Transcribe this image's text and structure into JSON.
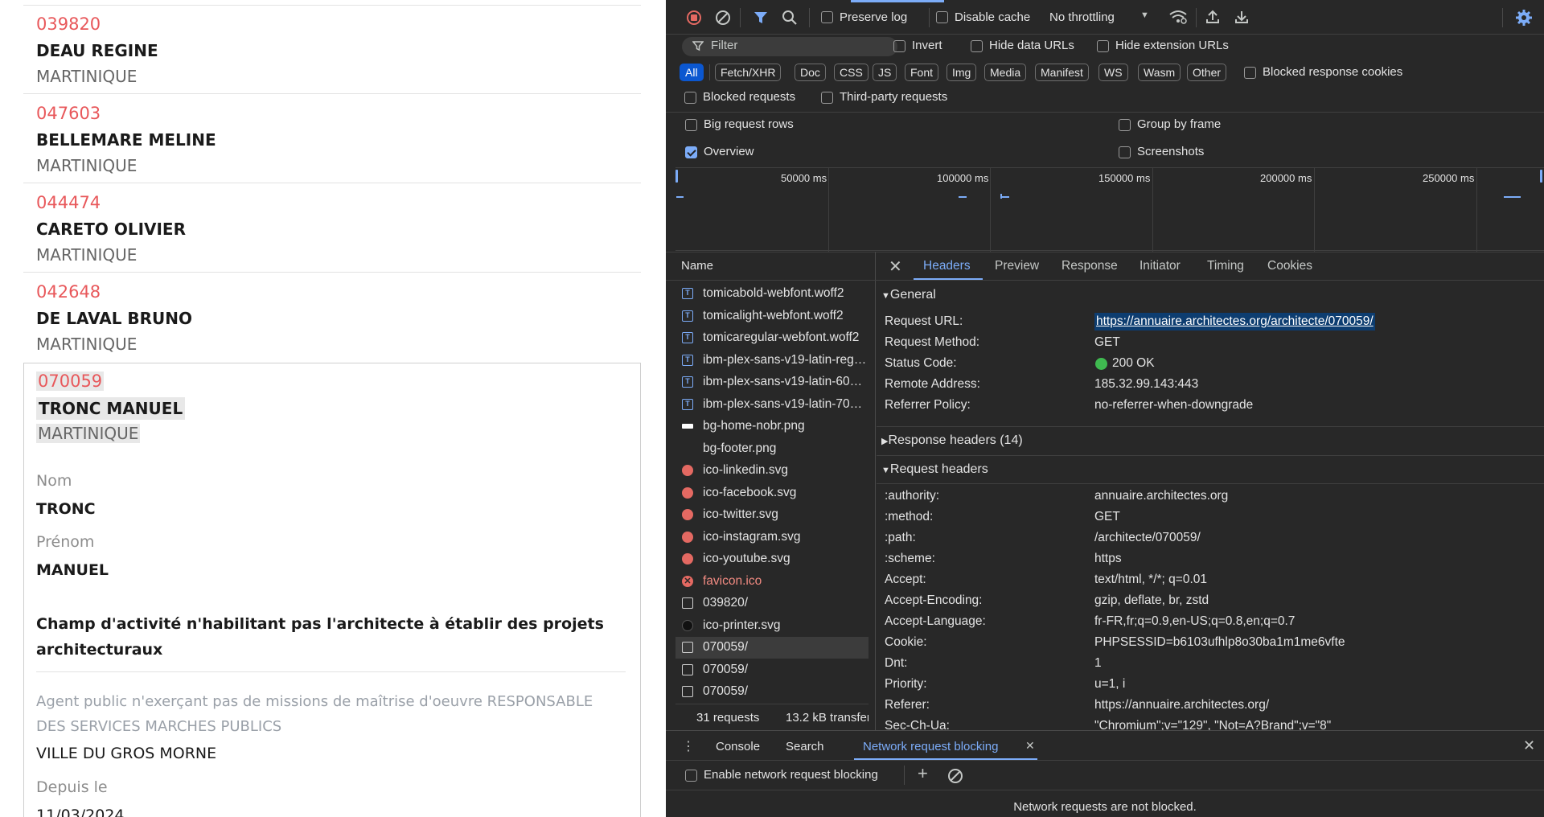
{
  "left_page": {
    "entries": [
      {
        "code": "039820",
        "name": "DEAU REGINE",
        "region": "MARTINIQUE"
      },
      {
        "code": "047603",
        "name": "BELLEMARE MELINE",
        "region": "MARTINIQUE"
      },
      {
        "code": "044474",
        "name": "CARETO OLIVIER",
        "region": "MARTINIQUE"
      },
      {
        "code": "042648",
        "name": "DE LAVAL BRUNO",
        "region": "MARTINIQUE"
      }
    ],
    "selected": {
      "code": "070059",
      "name": "TRONC MANUEL",
      "region": "MARTINIQUE",
      "nom_label": "Nom",
      "nom_value": "TRONC",
      "prenom_label": "Prénom",
      "prenom_value": "MANUEL",
      "activity_line1": "Champ d'activité n'habilitant pas l'architecte à établir des projets",
      "activity_line2": "architecturaux",
      "role_line1": "Agent public n'exerçant pas de missions de maîtrise d'oeuvre RESPONSABLE",
      "role_line2": "DES SERVICES MARCHES PUBLICS",
      "employer": "VILLE DU GROS MORNE",
      "since_label": "Depuis le",
      "since_value": "11/03/2024"
    }
  },
  "devtools": {
    "toolbar": {
      "preserve_log": "Preserve log",
      "disable_cache": "Disable cache",
      "throttling": "No throttling"
    },
    "filter": {
      "placeholder": "Filter",
      "invert": "Invert",
      "hide_data_urls": "Hide data URLs",
      "hide_extension_urls": "Hide extension URLs"
    },
    "type_filters": [
      "All",
      "Fetch/XHR",
      "Doc",
      "CSS",
      "JS",
      "Font",
      "Img",
      "Media",
      "Manifest",
      "WS",
      "Wasm",
      "Other"
    ],
    "blocked_response_cookies": "Blocked response cookies",
    "blocked_requests": "Blocked requests",
    "third_party_requests": "Third-party requests",
    "big_request_rows": "Big request rows",
    "group_by_frame": "Group by frame",
    "overview": "Overview",
    "screenshots": "Screenshots",
    "timeline_ticks": [
      "50000 ms",
      "100000 ms",
      "150000 ms",
      "200000 ms",
      "250000 ms"
    ],
    "name_header": "Name",
    "requests": [
      {
        "name": "tomicabold-webfont.woff2",
        "type": "font"
      },
      {
        "name": "tomicalight-webfont.woff2",
        "type": "font"
      },
      {
        "name": "tomicaregular-webfont.woff2",
        "type": "font"
      },
      {
        "name": "ibm-plex-sans-v19-latin-regular.woff2",
        "type": "font"
      },
      {
        "name": "ibm-plex-sans-v19-latin-600.woff2",
        "type": "font"
      },
      {
        "name": "ibm-plex-sans-v19-latin-700.woff2",
        "type": "font"
      },
      {
        "name": "bg-home-nobr.png",
        "type": "png"
      },
      {
        "name": "bg-footer.png",
        "type": "blank"
      },
      {
        "name": "ico-linkedin.svg",
        "type": "img"
      },
      {
        "name": "ico-facebook.svg",
        "type": "img"
      },
      {
        "name": "ico-twitter.svg",
        "type": "img"
      },
      {
        "name": "ico-instagram.svg",
        "type": "img"
      },
      {
        "name": "ico-youtube.svg",
        "type": "img"
      },
      {
        "name": "favicon.ico",
        "type": "error"
      },
      {
        "name": "039820/",
        "type": "doc"
      },
      {
        "name": "ico-printer.svg",
        "type": "printer"
      },
      {
        "name": "070059/",
        "type": "doc"
      },
      {
        "name": "070059/",
        "type": "doc"
      },
      {
        "name": "070059/",
        "type": "doc"
      }
    ],
    "summary_requests": "31 requests",
    "summary_transferred": "13.2 kB transferred",
    "tabs": [
      "Headers",
      "Preview",
      "Response",
      "Initiator",
      "Timing",
      "Cookies"
    ],
    "general": {
      "title": "General",
      "rows": [
        {
          "k": "Request URL:",
          "v": "https://annuaire.architectes.org/architecte/070059/"
        },
        {
          "k": "Request Method:",
          "v": "GET"
        },
        {
          "k": "Status Code:",
          "v": "200 OK"
        },
        {
          "k": "Remote Address:",
          "v": "185.32.99.143:443"
        },
        {
          "k": "Referrer Policy:",
          "v": "no-referrer-when-downgrade"
        }
      ]
    },
    "response_headers": "Response headers (14)",
    "request_headers": {
      "title": "Request headers",
      "rows": [
        {
          "k": ":authority:",
          "v": "annuaire.architectes.org"
        },
        {
          "k": ":method:",
          "v": "GET"
        },
        {
          "k": ":path:",
          "v": "/architecte/070059/"
        },
        {
          "k": ":scheme:",
          "v": "https"
        },
        {
          "k": "Accept:",
          "v": "text/html, */*; q=0.01"
        },
        {
          "k": "Accept-Encoding:",
          "v": "gzip, deflate, br, zstd"
        },
        {
          "k": "Accept-Language:",
          "v": "fr-FR,fr;q=0.9,en-US;q=0.8,en;q=0.7"
        },
        {
          "k": "Cookie:",
          "v": "PHPSESSID=b6103ufhlp8o30ba1m1me6vfte"
        },
        {
          "k": "Dnt:",
          "v": "1"
        },
        {
          "k": "Priority:",
          "v": "u=1, i"
        },
        {
          "k": "Referer:",
          "v": "https://annuaire.architectes.org/"
        },
        {
          "k": "Sec-Ch-Ua:",
          "v": "\"Chromium\";v=\"129\", \"Not=A?Brand\";v=\"8\""
        }
      ]
    },
    "drawer": {
      "tabs": [
        "Console",
        "Search",
        "Network request blocking"
      ],
      "enable_label": "Enable network request blocking",
      "status": "Network requests are not blocked."
    },
    "colors": {
      "accent": "#7cacf8",
      "active_pill": "#0b57d0",
      "status_ok": "#3fba50",
      "error": "#e46962",
      "code_red": "#e8585b"
    }
  }
}
